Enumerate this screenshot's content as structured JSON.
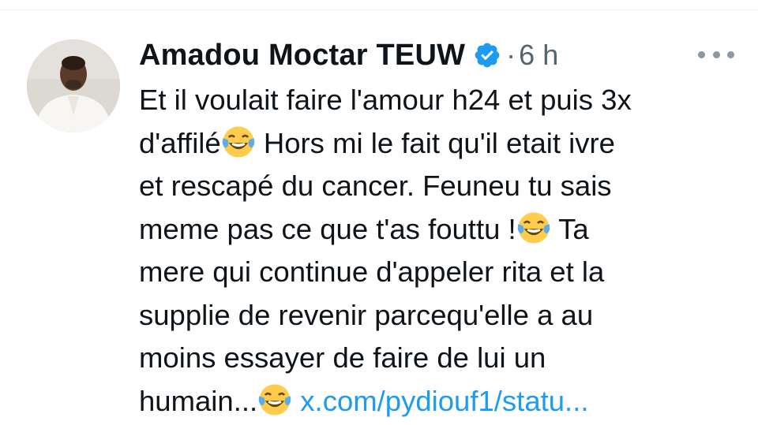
{
  "tweet": {
    "author_name": "Amadou Moctar TEUW",
    "separator": "·",
    "timestamp": "6 h",
    "verified_icon": "verified-badge-icon",
    "more_icon": "more-horizontal-icon",
    "accent_color": "#1d9bf0",
    "text_color": "#0f1419",
    "secondary_color": "#536471",
    "emoji": "😂",
    "lines": [
      "Et il voulait faire l'amour h24 et puis 3x",
      "d'affilé",
      " Hors mi le fait qu'il etait ivre",
      "et rescapé du cancer. Feuneu tu sais",
      "meme pas ce que t'as fouttu !",
      " Ta",
      "mere qui continue d'appeler rita et la",
      "supplie de revenir parcequ'elle a au",
      "moins essayer de faire de lui un",
      "humain..."
    ],
    "link_text": "x.com/pydiouf1/statu..."
  }
}
